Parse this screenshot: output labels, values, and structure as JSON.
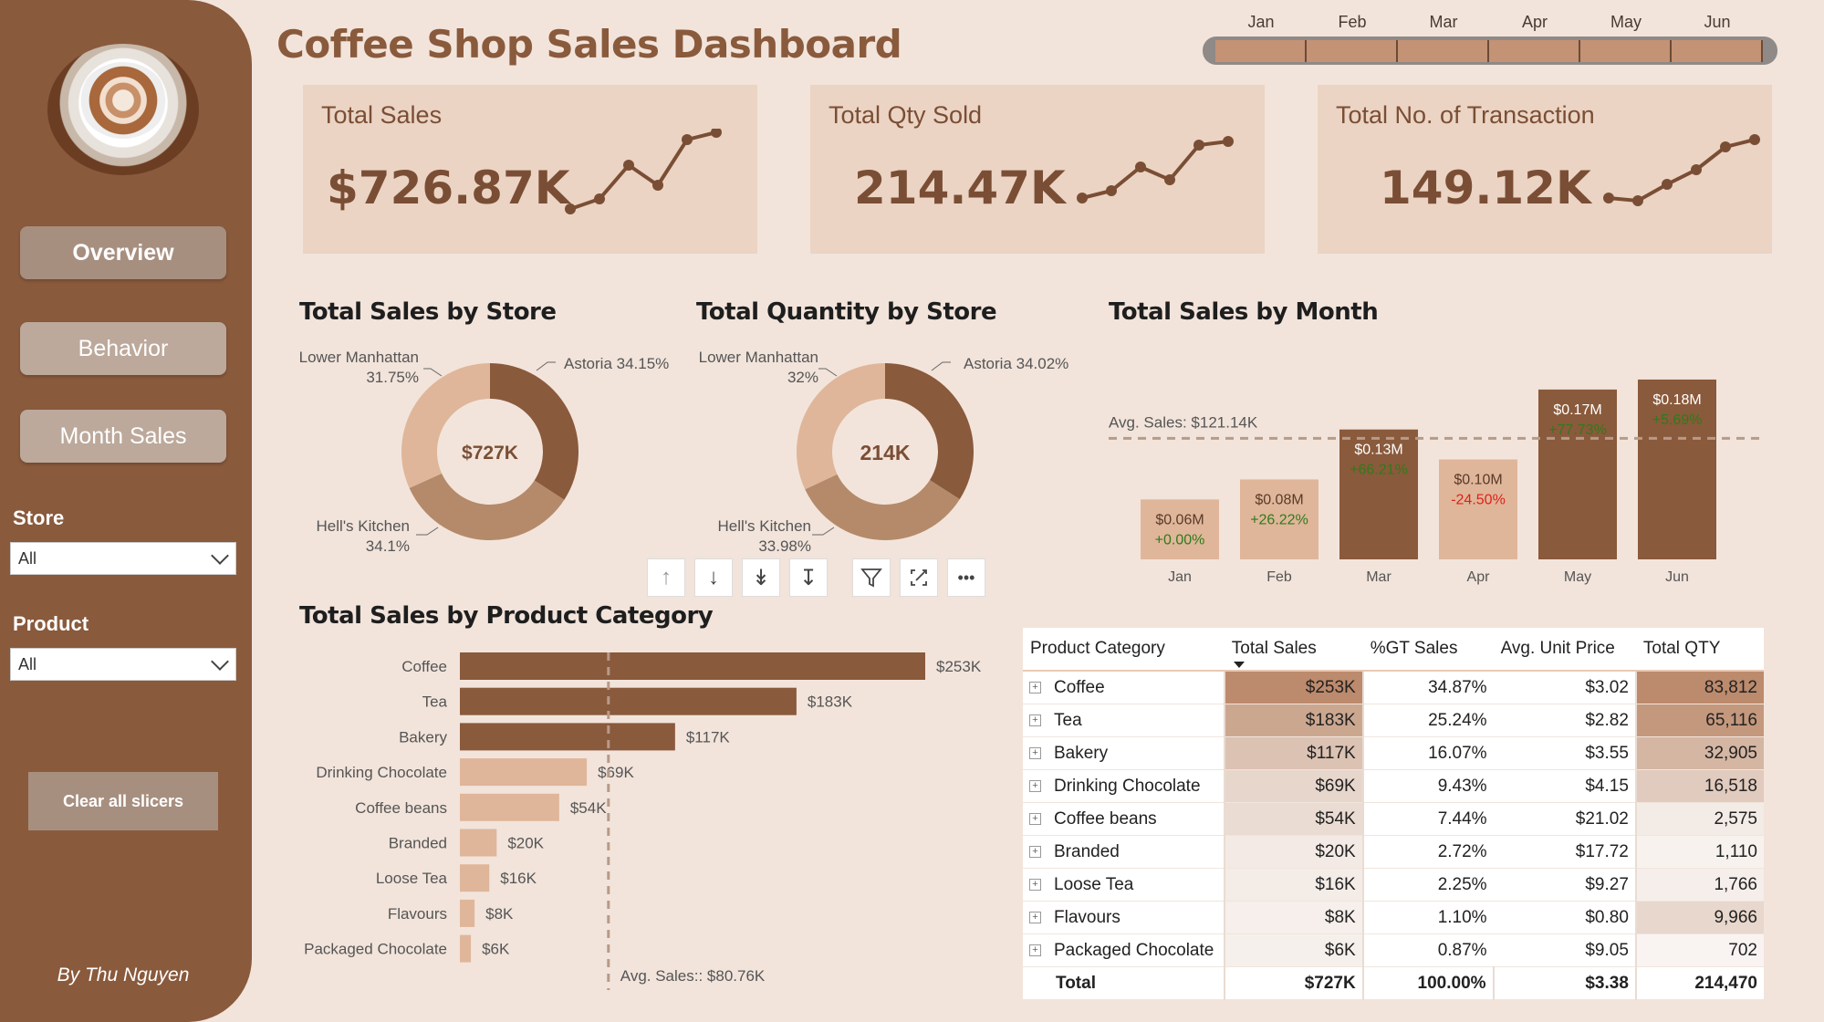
{
  "sidebar": {
    "nav": [
      "Overview",
      "Behavior",
      "Month Sales"
    ],
    "store_label": "Store",
    "store_value": "All",
    "product_label": "Product",
    "product_value": "All",
    "clear_label": "Clear all slicers",
    "byline": "By Thu Nguyen"
  },
  "header": {
    "title": "Coffee Shop Sales Dashboard",
    "months": [
      "Jan",
      "Feb",
      "Mar",
      "Apr",
      "May",
      "Jun"
    ]
  },
  "kpis": [
    {
      "label": "Total Sales",
      "value": "$726.87K"
    },
    {
      "label": "Total Qty Sold",
      "value": "214.47K"
    },
    {
      "label": "Total No. of Transaction",
      "value": "149.12K"
    }
  ],
  "sections": {
    "sales_by_store": "Total Sales by Store",
    "qty_by_store": "Total Quantity by Store",
    "sales_by_month": "Total Sales by Month",
    "sales_by_category": "Total Sales by Product Category"
  },
  "colors": {
    "dark": "#8a5a3c",
    "mid": "#b48a6a",
    "light": "#dfb69a",
    "bg": "#f2e4db"
  },
  "toolbar": [
    "arrow-up-icon",
    "arrow-down-icon",
    "double-arrow-down-icon",
    "drill-down-icon",
    "filter-icon",
    "focus-mode-icon",
    "more-options-icon"
  ],
  "chart_data": [
    {
      "type": "pie",
      "center_label": "$727K",
      "labels": [
        "Astoria",
        "Hell's Kitchen",
        "Lower Manhattan"
      ],
      "values": [
        34.15,
        34.1,
        31.75
      ],
      "label_text": [
        "Astoria 34.15%",
        "Hell's Kitchen",
        "34.1%",
        "Lower Manhattan",
        "31.75%"
      ]
    },
    {
      "type": "pie",
      "center_label": "214K",
      "labels": [
        "Astoria",
        "Hell's Kitchen",
        "Lower Manhattan"
      ],
      "values": [
        34.02,
        33.98,
        32
      ],
      "label_text": [
        "Astoria 34.02%",
        "Hell's Kitchen",
        "33.98%",
        "Lower Manhattan",
        "32%"
      ]
    },
    {
      "type": "bar",
      "categories": [
        "Jan",
        "Feb",
        "Mar",
        "Apr",
        "May",
        "Jun"
      ],
      "values": [
        0.06,
        0.08,
        0.13,
        0.1,
        0.17,
        0.18
      ],
      "value_labels": [
        "$0.06M",
        "$0.08M",
        "$0.13M",
        "$0.10M",
        "$0.17M",
        "$0.18M"
      ],
      "change_labels": [
        "+0.00%",
        "+26.22%",
        "+66.21%",
        "-24.50%",
        "+77.73%",
        "+5.69%"
      ],
      "avg_line": 0.12114,
      "avg_label": "Avg. Sales: $121.14K",
      "ylim": [
        0,
        0.19
      ]
    },
    {
      "type": "bar",
      "orientation": "horizontal",
      "categories": [
        "Coffee",
        "Tea",
        "Bakery",
        "Drinking Chocolate",
        "Coffee beans",
        "Branded",
        "Loose Tea",
        "Flavours",
        "Packaged Chocolate"
      ],
      "values": [
        253,
        183,
        117,
        69,
        54,
        20,
        16,
        8,
        6
      ],
      "value_labels": [
        "$253K",
        "$183K",
        "$117K",
        "$69K",
        "$54K",
        "$20K",
        "$16K",
        "$8K",
        "$6K"
      ],
      "avg_line": 80.76,
      "avg_label": "Avg. Sales:: $80.76K",
      "xlim": [
        0,
        253
      ]
    },
    {
      "type": "table",
      "columns": [
        "Product Category",
        "Total Sales",
        "%GT Sales",
        "Avg. Unit Price",
        "Total QTY"
      ],
      "rows": [
        [
          "Coffee",
          "$253K",
          "34.87%",
          "$3.02",
          "83,812"
        ],
        [
          "Tea",
          "$183K",
          "25.24%",
          "$2.82",
          "65,116"
        ],
        [
          "Bakery",
          "$117K",
          "16.07%",
          "$3.55",
          "32,905"
        ],
        [
          "Drinking Chocolate",
          "$69K",
          "9.43%",
          "$4.15",
          "16,518"
        ],
        [
          "Coffee beans",
          "$54K",
          "7.44%",
          "$21.02",
          "2,575"
        ],
        [
          "Branded",
          "$20K",
          "2.72%",
          "$17.72",
          "1,110"
        ],
        [
          "Loose Tea",
          "$16K",
          "2.25%",
          "$9.27",
          "1,766"
        ],
        [
          "Flavours",
          "$8K",
          "1.10%",
          "$0.80",
          "9,966"
        ],
        [
          "Packaged Chocolate",
          "$6K",
          "0.87%",
          "$9.05",
          "702"
        ]
      ],
      "total": [
        "Total",
        "$727K",
        "100.00%",
        "$3.38",
        "214,470"
      ],
      "sales_values": [
        253,
        183,
        117,
        69,
        54,
        20,
        16,
        8,
        6
      ],
      "qty_values": [
        83812,
        65116,
        32905,
        16518,
        2575,
        1110,
        1766,
        9966,
        702
      ]
    }
  ]
}
